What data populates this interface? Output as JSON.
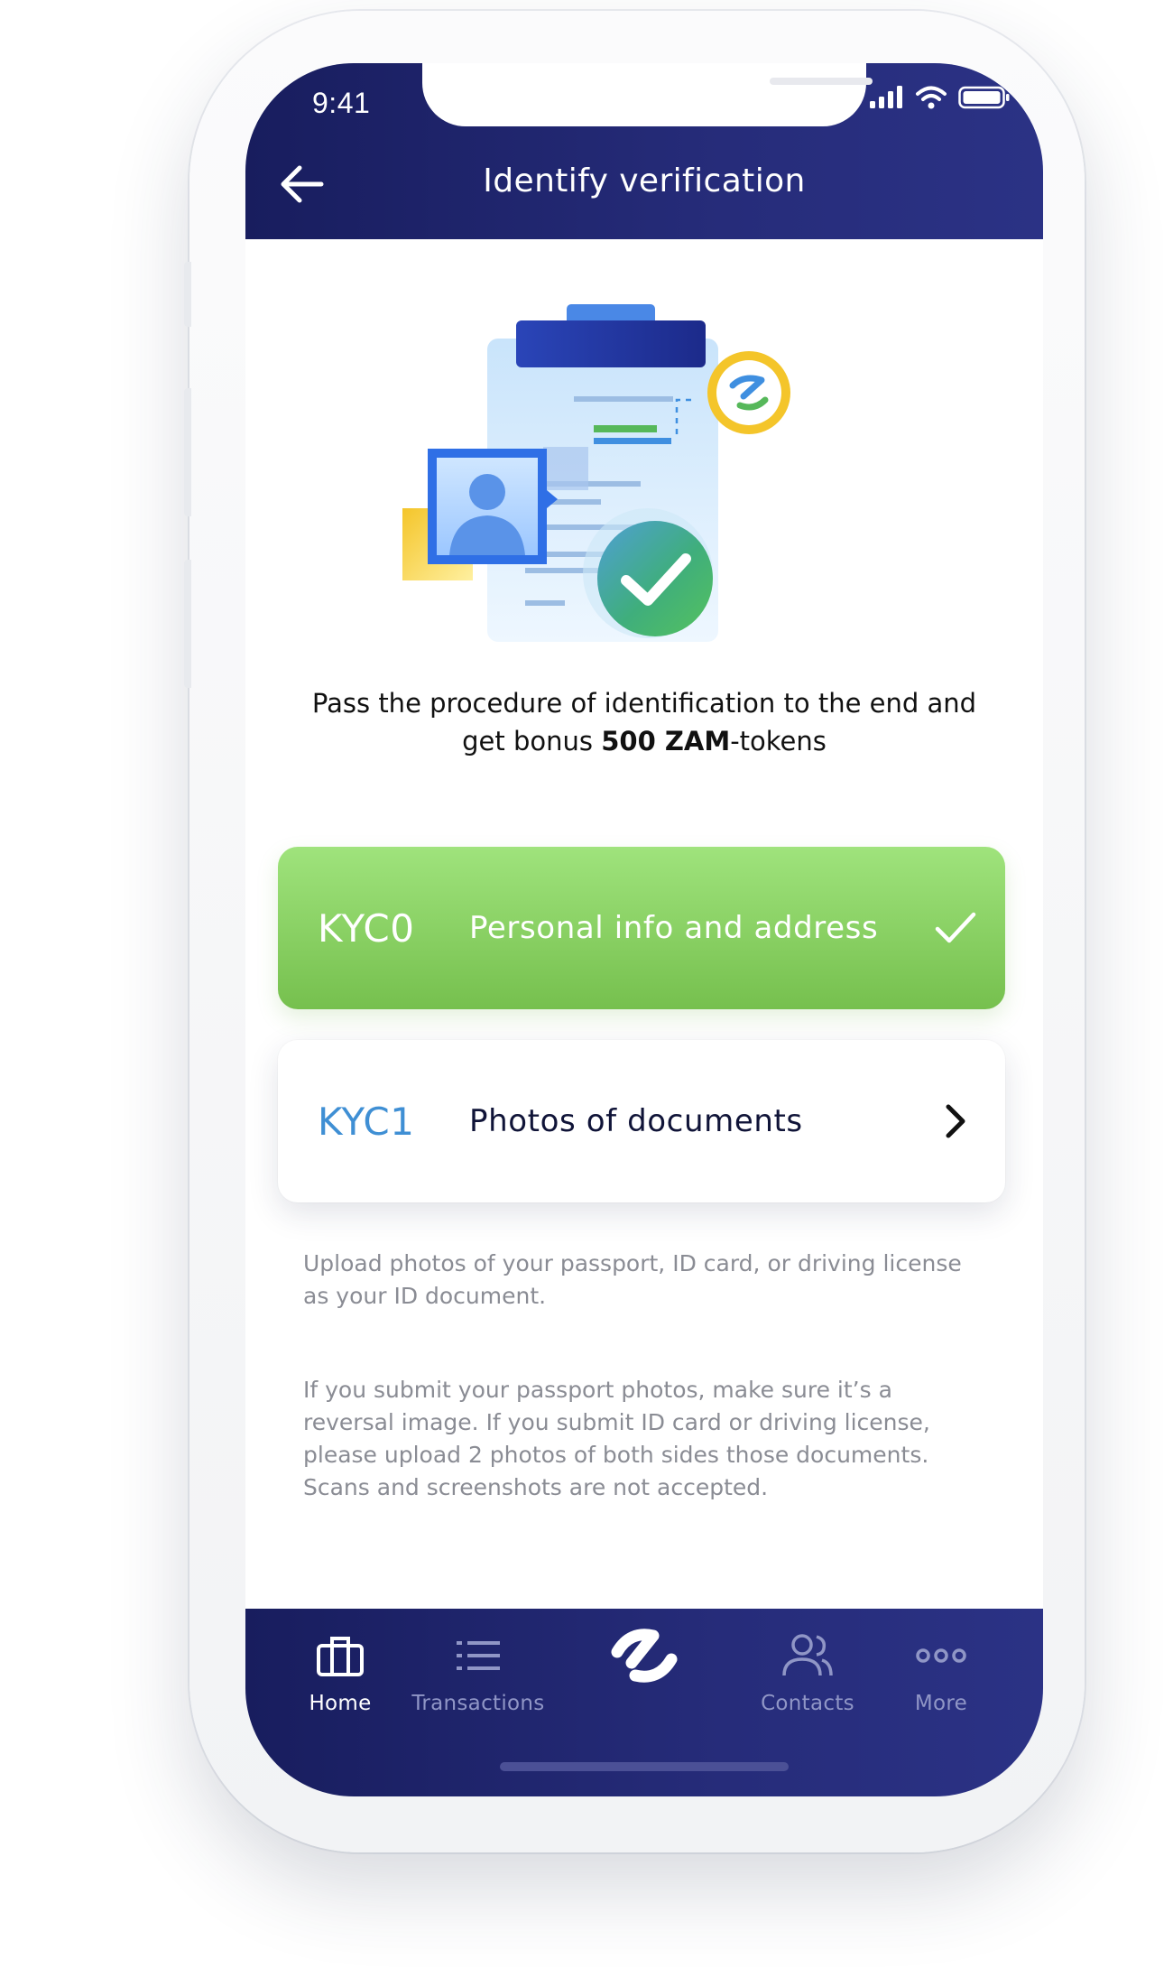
{
  "status_bar": {
    "time": "9:41"
  },
  "header": {
    "title": "Identify verification",
    "back_icon": "arrow-left-icon"
  },
  "intro": {
    "text_before": "Pass the procedure of identification to the end and get bonus ",
    "bonus_amount": "500 ZAM",
    "text_after": "-tokens"
  },
  "kyc_steps": [
    {
      "code": "KYC0",
      "label": "Personal info and address",
      "status": "completed",
      "icon": "checkmark-icon"
    },
    {
      "code": "KYC1",
      "label": "Photos of documents",
      "status": "pending",
      "icon": "chevron-right-icon"
    }
  ],
  "info": {
    "paragraph1": "Upload photos of your passport, ID card, or driving license as your ID document.",
    "paragraph2": "If you submit your passport photos, make sure it’s a reversal image. If you submit ID card or driving license, please upload 2 photos of both sides those documents. Scans and screenshots are not accepted."
  },
  "bottom_nav": {
    "items": [
      {
        "label": "Home",
        "icon": "briefcase-icon",
        "active": true
      },
      {
        "label": "Transactions",
        "icon": "list-icon",
        "active": false
      },
      {
        "label": "",
        "icon": "zam-logo-icon",
        "active": false
      },
      {
        "label": "Contacts",
        "icon": "contacts-icon",
        "active": false
      },
      {
        "label": "More",
        "icon": "more-dots-icon",
        "active": false
      }
    ]
  },
  "colors": {
    "header_bg": "#1f2470",
    "completed_green": "#8fd668",
    "kyc1_code_blue": "#3f8fd4",
    "nav_inactive": "#9096c6",
    "info_text": "#8a8c94"
  }
}
